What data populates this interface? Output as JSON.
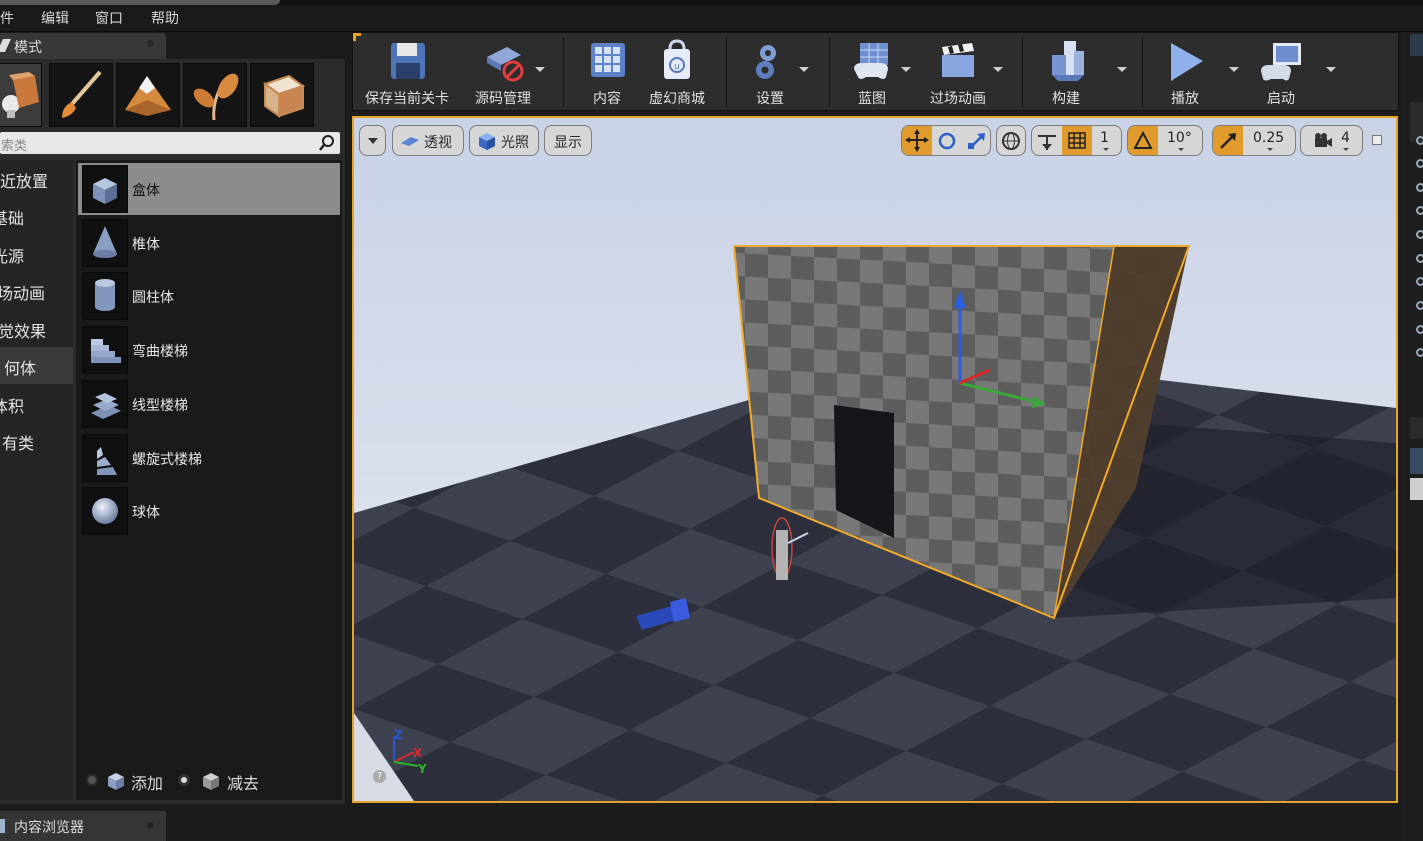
{
  "menu": {
    "items": [
      "件",
      "编辑",
      "窗口",
      "帮助"
    ]
  },
  "modes_panel": {
    "tab_title": "模式",
    "mode_buttons": [
      "place-mode-icon",
      "paint-mode-icon",
      "landscape-mode-icon",
      "foliage-mode-icon",
      "geometry-edit-mode-icon"
    ],
    "search_placeholder": "搜索类",
    "categories": [
      "最近放置",
      "基础",
      "光源",
      "过场动画",
      "视觉效果",
      "几何体",
      "体积",
      "所有类"
    ],
    "categories_shown": [
      "近放置",
      "基础",
      "光源",
      "场动画",
      "觉效果",
      "何体",
      "体积",
      "有类"
    ],
    "selected_category": "几何体",
    "items": [
      "盒体",
      "椎体",
      "圆柱体",
      "弯曲楼梯",
      "线型楼梯",
      "螺旋式楼梯",
      "球体"
    ],
    "selected_item": "盒体",
    "add_label": "添加",
    "subtract_label": "减去",
    "subtract_selected": true
  },
  "content_browser": {
    "tab_title": "内容浏览器"
  },
  "toolbar": {
    "buttons": [
      {
        "label": "保存当前关卡",
        "icon": "save-icon",
        "dropdown": false
      },
      {
        "label": "源码管理",
        "icon": "source-control-icon",
        "dropdown": true
      },
      {
        "label": "内容",
        "icon": "content-icon",
        "dropdown": false
      },
      {
        "label": "虚幻商城",
        "icon": "marketplace-icon",
        "dropdown": false
      },
      {
        "label": "设置",
        "icon": "settings-gear-icon",
        "dropdown": true
      },
      {
        "label": "蓝图",
        "icon": "blueprint-icon",
        "dropdown": true
      },
      {
        "label": "过场动画",
        "icon": "clapper-icon",
        "dropdown": true
      },
      {
        "label": "构建",
        "icon": "build-icon",
        "dropdown": true
      },
      {
        "label": "播放",
        "icon": "play-icon",
        "dropdown": true
      },
      {
        "label": "启动",
        "icon": "launch-icon",
        "dropdown": true
      }
    ]
  },
  "viewport": {
    "perspective_label": "透视",
    "lit_label": "光照",
    "show_label": "显示",
    "grid_snap_value": "1",
    "rotation_snap_value": "10°",
    "scale_snap_value": "0.25",
    "camera_speed_value": "4",
    "axis_labels": {
      "z": "Z",
      "x": "X",
      "y": "Y"
    },
    "help_label": "?"
  },
  "colors": {
    "accent": "#e6a327",
    "selection_outline": "#e6a327",
    "panel": "#2b2b2b",
    "toolbar": "#2d2d2d"
  }
}
